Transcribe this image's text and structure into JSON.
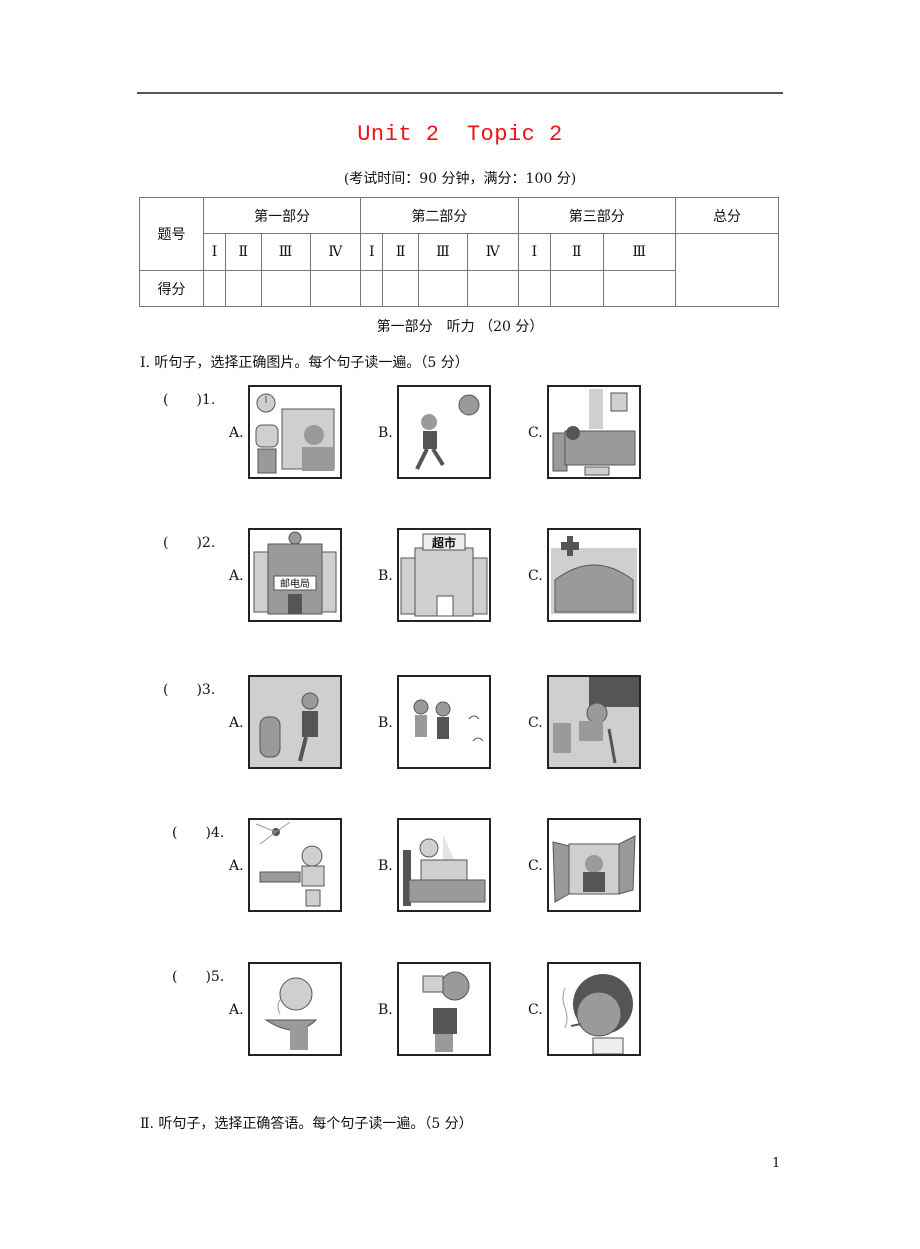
{
  "header": {
    "title_unit": "Unit 2",
    "title_topic": "Topic 2",
    "subtitle": "(考试时间：90 分钟，满分：100 分)"
  },
  "score_table": {
    "row_header_question": "题号",
    "row_header_score": "得分",
    "parts": [
      "第一部分",
      "第二部分",
      "第三部分"
    ],
    "total": "总分",
    "part1_cols": [
      "Ⅰ",
      "Ⅱ",
      "Ⅲ",
      "Ⅳ"
    ],
    "part2_cols": [
      "Ⅰ",
      "Ⅱ",
      "Ⅲ",
      "Ⅳ"
    ],
    "part3_cols": [
      "Ⅰ",
      "Ⅱ",
      "Ⅲ"
    ]
  },
  "section": {
    "heading": "第一部分　听力 （20 分）",
    "part1_instruction": "Ⅰ. 听句子，选择正确图片。每个句子读一遍。（5 分）",
    "part2_instruction": "Ⅱ. 听句子，选择正确答语。每个句子读一遍。（5 分）"
  },
  "questions": [
    {
      "number": "(　　)1.",
      "options": [
        {
          "label": "A.",
          "picture": "girl watching TV at home"
        },
        {
          "label": "B.",
          "picture": "girl running under the sun"
        },
        {
          "label": "C.",
          "picture": "person sick in bed"
        }
      ]
    },
    {
      "number": "(　　)2.",
      "options": [
        {
          "label": "A.",
          "picture": "post office building",
          "sign": "邮电局"
        },
        {
          "label": "B.",
          "picture": "supermarket building",
          "sign": "超市"
        },
        {
          "label": "C.",
          "picture": "hospital building"
        }
      ]
    },
    {
      "number": "(　　)3.",
      "options": [
        {
          "label": "A.",
          "picture": "boy posting a letter"
        },
        {
          "label": "B.",
          "picture": "boys throwing banana peels"
        },
        {
          "label": "C.",
          "picture": "boy sweeping the classroom"
        }
      ]
    },
    {
      "number": "(　　)4.",
      "options": [
        {
          "label": "A.",
          "picture": "girl reading under a bright lamp"
        },
        {
          "label": "B.",
          "picture": "girl reading in bed"
        },
        {
          "label": "C.",
          "picture": "girl at an open window"
        }
      ]
    },
    {
      "number": "(　　)5.",
      "options": [
        {
          "label": "A.",
          "picture": "boy smelling hot soup"
        },
        {
          "label": "B.",
          "picture": "boy drinking"
        },
        {
          "label": "C.",
          "picture": "boy smoking"
        }
      ]
    }
  ],
  "footer": {
    "page_number": "1"
  }
}
